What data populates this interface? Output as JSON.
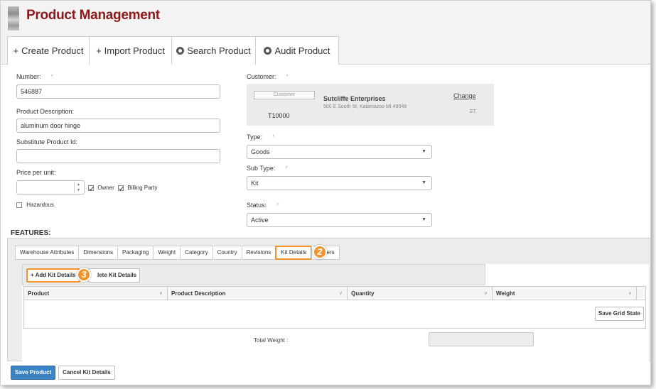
{
  "app": {
    "title": "Product Management"
  },
  "top_tabs": [
    {
      "icon": "plus-icon",
      "label": "Create Product"
    },
    {
      "icon": "plus-icon",
      "label": "Import Product"
    },
    {
      "icon": "circle-icon",
      "label": "Search Product"
    },
    {
      "icon": "circle-icon",
      "label": "Audit Product"
    }
  ],
  "form": {
    "number": {
      "label": "Number:",
      "required": "*",
      "value": "546887"
    },
    "product_description": {
      "label": "Product Description:",
      "value": "aluminum door hinge"
    },
    "substitute_product_id": {
      "label": "Substitute Product Id:",
      "value": ""
    },
    "price_per_unit": {
      "label": "Price per unit:",
      "value": ""
    },
    "owner": {
      "label": "Owner",
      "checked": true
    },
    "billing_party": {
      "label": "Billing Party",
      "checked": true
    },
    "hazardous": {
      "label": "Hazardous",
      "checked": false
    }
  },
  "customer": {
    "label": "Customer:",
    "required": "*",
    "button_label": "Customer",
    "code": "T10000",
    "name": "Sutcliffe Enterprises",
    "address": "500 E South St, Kalamazoo MI 49048",
    "change_link": "Change",
    "tz": "ET"
  },
  "type": {
    "label": "Type:",
    "required": "*",
    "value": "Goods"
  },
  "sub_type": {
    "label": "Sub Type:",
    "required": "*",
    "value": "Kit"
  },
  "status": {
    "label": "Status:",
    "required": "*",
    "value": "Active"
  },
  "features": {
    "title": "FEATURES:",
    "tabs": [
      "Warehouse Attributes",
      "Dimensions",
      "Packaging",
      "Weight",
      "Category",
      "Country",
      "Revisions",
      "Kit Details",
      "ters"
    ],
    "active_tab": "Kit Details",
    "callouts": {
      "tab": "2",
      "add_button": "3"
    },
    "kit": {
      "add_label": "+ Add Kit Details",
      "delete_label": "lete Kit Details",
      "columns": [
        "Product",
        "Product Description",
        "Quantity",
        "Weight"
      ],
      "save_grid_label": "Save Grid State",
      "total_weight_label": "Total Weight :",
      "total_weight_value": ""
    }
  },
  "footer": {
    "save_label": "Save Product",
    "cancel_label": "Cancel Kit Details"
  },
  "colors": {
    "title": "#8b1a1a",
    "highlight": "#f0932b",
    "primary_button": "#3a84c5"
  }
}
